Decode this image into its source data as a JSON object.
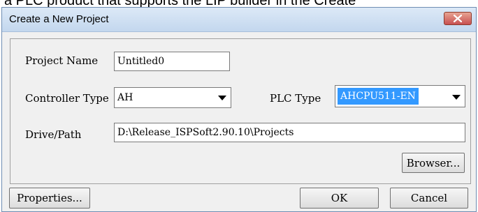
{
  "context_text": "a PLC product that supports the LIP builder in the Create",
  "dialog": {
    "title": "Create a New Project",
    "close_icon": "close-icon"
  },
  "form": {
    "project_name_label": "Project Name",
    "project_name_value": "Untitled0",
    "controller_type_label": "Controller Type",
    "controller_type_value": "AH",
    "plc_type_label": "PLC Type",
    "plc_type_value": "AHCPU511-EN",
    "drive_path_label": "Drive/Path",
    "drive_path_value": "D:\\Release_ISPSoft2.90.10\\Projects",
    "browser_label": "Browser..."
  },
  "footer": {
    "properties_label": "Properties...",
    "ok_label": "OK",
    "cancel_label": "Cancel"
  },
  "colors": {
    "selection": "#3399ff",
    "close_button": "#c75050"
  }
}
